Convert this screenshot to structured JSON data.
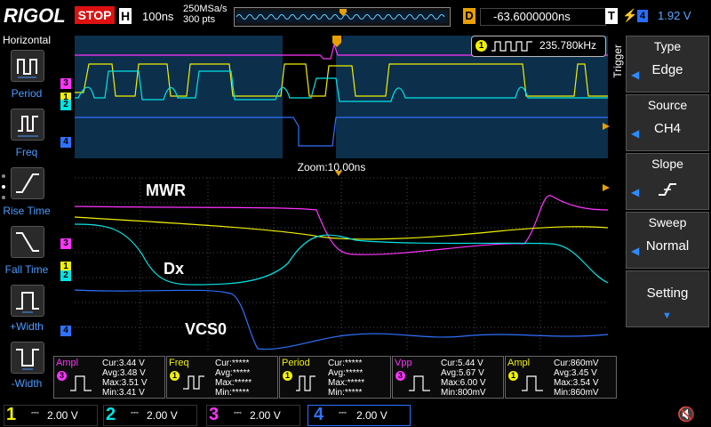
{
  "header": {
    "brand": "RIGOL",
    "run_state": "STOP",
    "timebase_label": "H",
    "timebase": "100ns",
    "sample_rate": "250MSa/s",
    "points": "300 pts",
    "delay_label": "D",
    "delay": "-63.6000000ns",
    "trigger_label": "T",
    "trigger_channel": "4",
    "trigger_level": "1.92 V"
  },
  "left_menu": {
    "title": "Horizontal",
    "items": [
      {
        "label": "Period"
      },
      {
        "label": "Freq"
      },
      {
        "label": "Rise Time"
      },
      {
        "label": "Fall Time"
      },
      {
        "label": "+Width"
      },
      {
        "label": "-Width"
      }
    ]
  },
  "display": {
    "zoom_label": "Zoom:10.00ns",
    "counter_channel": "1",
    "counter_value": "235.780kHz",
    "annotations": [
      "MWR",
      "Dx",
      "VCS0"
    ],
    "channel_markers": [
      "1",
      "2",
      "3",
      "4"
    ],
    "trigger_marker": "T",
    "colors": {
      "ch1": "#f0f000",
      "ch2": "#00e5e5",
      "ch3": "#ff33ff",
      "ch4": "#2f72ff",
      "grid": "#4a4a4a",
      "window": "#0c2f4c"
    }
  },
  "right_menu": {
    "side_title": "Trigger",
    "type": {
      "title": "Type",
      "value": "Edge"
    },
    "source": {
      "title": "Source",
      "value": "CH4"
    },
    "slope": {
      "title": "Slope",
      "value": ""
    },
    "sweep": {
      "title": "Sweep",
      "value": "Normal"
    },
    "setting": {
      "title": "Setting"
    }
  },
  "measurements": [
    {
      "name": "Ampl",
      "channel": "3",
      "cur": "Cur:3.44 V",
      "avg": "Avg:3.48 V",
      "max": "Max:3.51 V",
      "min": "Min:3.41 V",
      "color": "#ff33ff"
    },
    {
      "name": "Freq",
      "channel": "1",
      "cur": "Cur:*****",
      "avg": "Avg:*****",
      "max": "Max:*****",
      "min": "Min:*****",
      "color": "#f0f000"
    },
    {
      "name": "Period",
      "channel": "1",
      "cur": "Cur:*****",
      "avg": "Avg:*****",
      "max": "Max:*****",
      "min": "Min:*****",
      "color": "#f0f000"
    },
    {
      "name": "Vpp",
      "channel": "3",
      "cur": "Cur:5.44 V",
      "avg": "Avg:5.67 V",
      "max": "Max:6.00 V",
      "min": "Min:800mV",
      "color": "#ff33ff"
    },
    {
      "name": "Ampl",
      "channel": "1",
      "cur": "Cur:860mV",
      "avg": "Avg:3.45 V",
      "max": "Max:3.54 V",
      "min": "Min:860mV",
      "color": "#f0f000"
    }
  ],
  "channels": [
    {
      "num": "1",
      "scale": "2.00 V",
      "color": "#f0f000"
    },
    {
      "num": "2",
      "scale": "2.00 V",
      "color": "#00e5e5"
    },
    {
      "num": "3",
      "scale": "2.00 V",
      "color": "#ff33ff"
    },
    {
      "num": "4",
      "scale": "2.00 V",
      "color": "#2f72ff"
    }
  ]
}
